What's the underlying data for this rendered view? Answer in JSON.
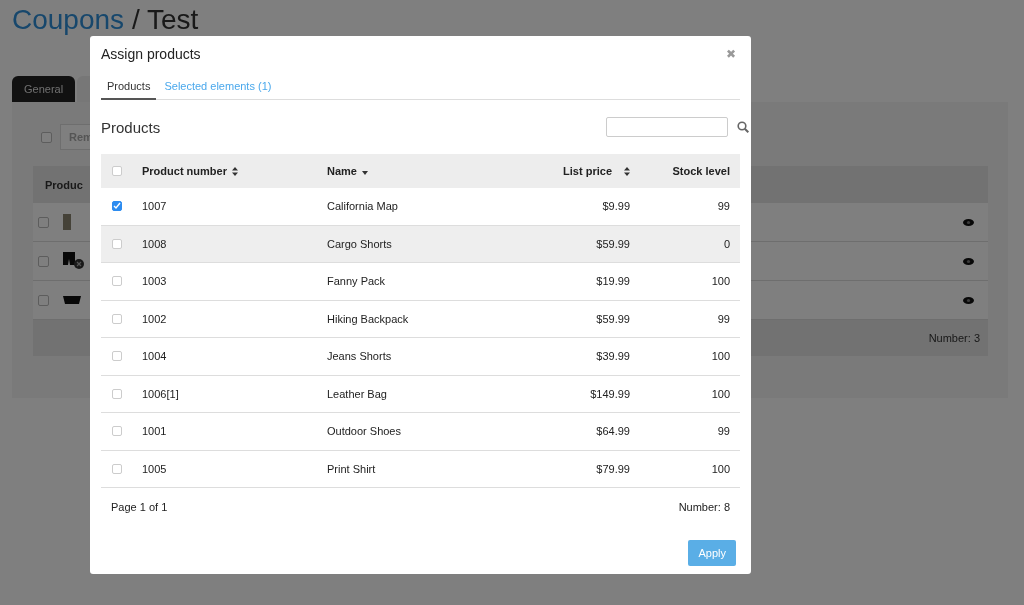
{
  "page": {
    "breadcrumb_link": "Coupons",
    "breadcrumb_rest": "/ Test",
    "tabs": [
      {
        "label": "General",
        "selected": true
      }
    ],
    "toolbar_checked": false,
    "toolbar_button": "Rem",
    "table_header": "Produc",
    "rows": [
      {
        "kind": "map",
        "checked": false
      },
      {
        "kind": "shorts",
        "checked": false
      },
      {
        "kind": "bag",
        "checked": false
      }
    ],
    "footer": "Number: 3"
  },
  "dialog": {
    "title": "Assign products",
    "close": "✖",
    "tabs": [
      {
        "label": "Products",
        "selected": true
      },
      {
        "label": "Selected elements (1)",
        "selected": false
      }
    ],
    "heading": "Products",
    "columns": [
      {
        "label": "Product number",
        "kind": "sortable"
      },
      {
        "label": "Name",
        "kind": "sorted-desc"
      },
      {
        "label": "List price",
        "kind": "sortable"
      },
      {
        "label": "Stock level",
        "kind": "plain"
      }
    ],
    "header_checked": false,
    "rows": [
      {
        "number": "1007",
        "name": "California Map",
        "price": "$9.99",
        "stock": "99",
        "checked": true,
        "highlighted": false
      },
      {
        "number": "1008",
        "name": "Cargo Shorts",
        "price": "$59.99",
        "stock": "0",
        "checked": false,
        "highlighted": true
      },
      {
        "number": "1003",
        "name": "Fanny Pack",
        "price": "$19.99",
        "stock": "100",
        "checked": false,
        "highlighted": false
      },
      {
        "number": "1002",
        "name": "Hiking Backpack",
        "price": "$59.99",
        "stock": "99",
        "checked": false,
        "highlighted": false
      },
      {
        "number": "1004",
        "name": "Jeans Shorts",
        "price": "$39.99",
        "stock": "100",
        "checked": false,
        "highlighted": false
      },
      {
        "number": "1006[1]",
        "name": "Leather Bag",
        "price": "$149.99",
        "stock": "100",
        "checked": false,
        "highlighted": false
      },
      {
        "number": "1001",
        "name": "Outdoor Shoes",
        "price": "$64.99",
        "stock": "99",
        "checked": false,
        "highlighted": false
      },
      {
        "number": "1005",
        "name": "Print Shirt",
        "price": "$79.99",
        "stock": "100",
        "checked": false,
        "highlighted": false
      }
    ],
    "pagination": "Page 1 of 1",
    "count": "Number: 8",
    "apply": "Apply"
  }
}
